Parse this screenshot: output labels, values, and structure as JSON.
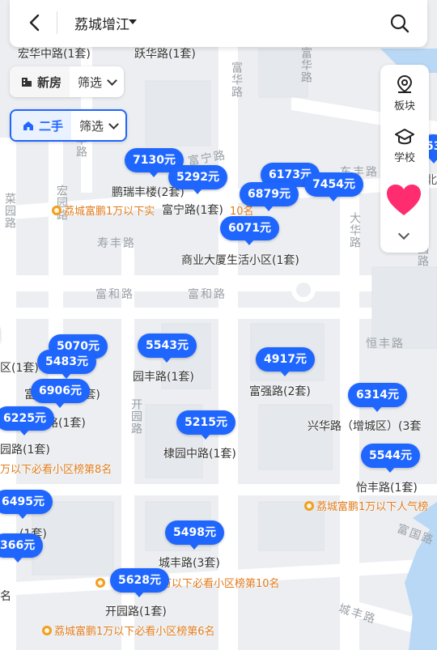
{
  "header": {
    "city": "荔城增江",
    "back_icon": "chevron-left-icon",
    "search_icon": "search-icon"
  },
  "filters": {
    "new_house": {
      "label": "新房",
      "filter": "筛选"
    },
    "second_hand": {
      "label": "二手",
      "filter": "筛选"
    }
  },
  "side_panel": {
    "items": [
      {
        "label": "板块",
        "icon": "map-pin-icon"
      },
      {
        "label": "学校",
        "icon": "graduation-cap-icon"
      }
    ],
    "accent": "#ff2d6f"
  },
  "roads": {
    "fuhua": "富华路",
    "fuhua2": "富华路",
    "funing": "富宁路",
    "hongyuan": "宏园路",
    "caiyuan": "菜园路",
    "shoufeng": "寿丰路",
    "fuhe1": "富和路",
    "fuhe2": "富和路",
    "dahua": "大华路",
    "hengfeng": "恒丰路",
    "kaiyuan": "开园路",
    "fuguo": "富国路",
    "chengfeng": "城丰路",
    "dongfeng": "东丰路",
    "ronghua": "荣华路",
    "yuyuan": "园路",
    "bei": "北"
  },
  "areas": [
    {
      "name": "宏华中路(1套)"
    },
    {
      "name": "跃华路(1套)"
    },
    {
      "name": "鹏瑞丰楼(2套)"
    },
    {
      "name": "富宁路(1套)"
    },
    {
      "name": "商业大厦生活小区(1套)"
    },
    {
      "name": "园丰路(1套)"
    },
    {
      "name": "富强路(2套)"
    },
    {
      "name": "兴华路（增城区）(3套"
    },
    {
      "name": "棣园中路(1套)"
    },
    {
      "name": "怡丰路(1套)"
    },
    {
      "name": "城丰路(3套)"
    },
    {
      "name": "开园路(1套)"
    },
    {
      "name": "区(1套)"
    },
    {
      "name": "富"
    },
    {
      "name": "(1套)"
    },
    {
      "name": "路(1套)"
    },
    {
      "name": "园路(1套)"
    },
    {
      "name": "(1套)"
    },
    {
      "name": "名"
    }
  ],
  "rankings": [
    {
      "text": "荔城富鹏1万以下实"
    },
    {
      "text": "10名"
    },
    {
      "text": "万以下必看小区榜第8名"
    },
    {
      "text": "荔城富鹏1万以下人气榜"
    },
    {
      "text": "万以下必看小区榜第10名"
    },
    {
      "text": "荔城富鹏1万以下必看小区榜第6名"
    }
  ],
  "prices": [
    "7130元",
    "5292元",
    "6173元",
    "7454元",
    "6879元",
    "6071元",
    "5070元",
    "5483元",
    "6906元",
    "5543元",
    "4917元",
    "6314元",
    "6225元",
    "5215元",
    "5544元",
    "6495元",
    "5498元",
    "366元",
    "5628元",
    "53"
  ],
  "colors": {
    "pin": "#1f66ff",
    "rank": "#e07b1c",
    "road": "#9aa0a6",
    "water": "#b8d8f5"
  }
}
